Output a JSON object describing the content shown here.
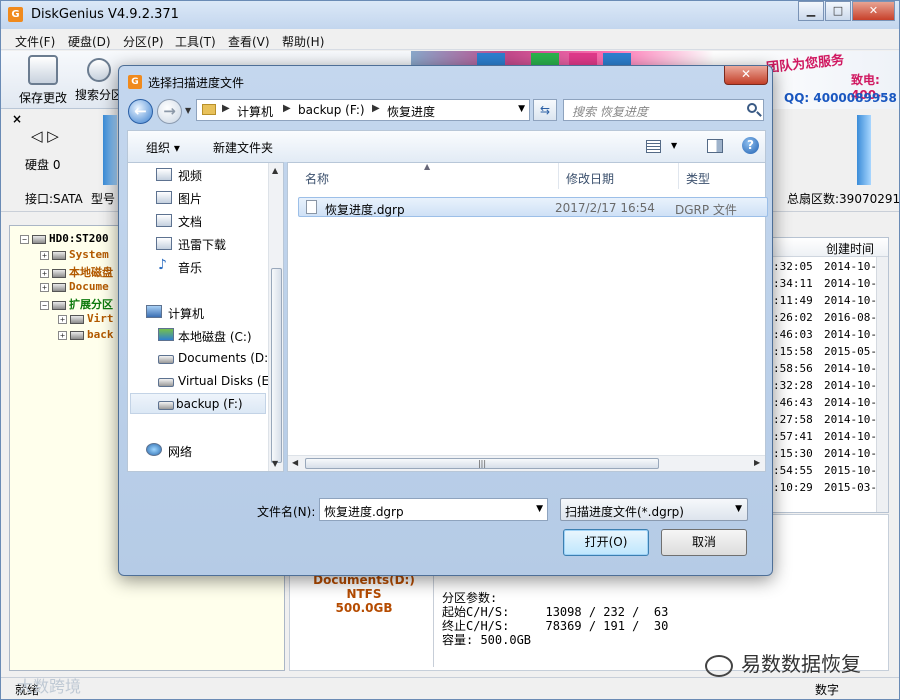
{
  "app": {
    "title": "DiskGenius V4.9.2.371",
    "logo": "G",
    "window_buttons": [
      "▁",
      "□",
      "✕"
    ]
  },
  "menu": [
    "文件(F)",
    "硬盘(D)",
    "分区(P)",
    "工具(T)",
    "查看(V)",
    "帮助(H)"
  ],
  "toolbar": {
    "save_label": "保存更改",
    "search_label": "搜索分区"
  },
  "banner": {
    "text1": "团队为您服务",
    "text2": "致电: 400-",
    "qq": "QQ: 4000089958"
  },
  "diskstrip": {
    "close": "×",
    "arrows": "◁ ▷",
    "disk_label": "硬盘 0",
    "interface": "接口:SATA",
    "model": "型号",
    "total_sectors": "总扇区数:39070291"
  },
  "tree": [
    {
      "label": "HD0:ST200",
      "indent": 0,
      "color": "#000000"
    },
    {
      "label": "System",
      "indent": 1,
      "color": "#b35a00"
    },
    {
      "label": "本地磁盘",
      "indent": 1,
      "color": "#b35a00"
    },
    {
      "label": "Docume",
      "indent": 1,
      "color": "#b35a00"
    },
    {
      "label": "扩展分区",
      "indent": 1,
      "color": "#0d7a0d"
    },
    {
      "label": "Virt",
      "indent": 2,
      "color": "#b35a00"
    },
    {
      "label": "back",
      "indent": 2,
      "color": "#b35a00"
    }
  ],
  "list": {
    "header": "创建时间",
    "rows": [
      {
        "time": ":32:05",
        "date": "2014-10-"
      },
      {
        "time": ":34:11",
        "date": "2014-10-"
      },
      {
        "time": ":11:49",
        "date": "2014-10-"
      },
      {
        "time": ":26:02",
        "date": "2016-08-"
      },
      {
        "time": ":46:03",
        "date": "2014-10-"
      },
      {
        "time": ":15:58",
        "date": "2015-05-"
      },
      {
        "time": ":58:56",
        "date": "2014-10-"
      },
      {
        "time": ":32:28",
        "date": "2014-10-"
      },
      {
        "time": ":46:43",
        "date": "2014-10-"
      },
      {
        "time": ":27:58",
        "date": "2014-10-"
      },
      {
        "time": ":57:41",
        "date": "2014-10-"
      },
      {
        "time": ":15:30",
        "date": "2014-10-"
      },
      {
        "time": ":54:55",
        "date": "2015-10-"
      },
      {
        "time": ":10:29",
        "date": "2015-03-"
      }
    ]
  },
  "partition": {
    "name": "Documents(D:)",
    "fs": "NTFS",
    "size": "500.0GB",
    "params_title": "分区参数:",
    "start": "起始C/H/S:     13098 / 232 /  63",
    "end": "终止C/H/S:     78369 / 191 /  30",
    "capacity": "容量: 500.0GB"
  },
  "status": {
    "left": "就绪",
    "right": "数字"
  },
  "watermarks": {
    "left": "大数跨境",
    "right": "易数数据恢复"
  },
  "dialog": {
    "title": "选择扫描进度文件",
    "logo": "G",
    "close": "✕",
    "breadcrumb": [
      "计算机",
      "backup (F:)",
      "恢复进度"
    ],
    "search_placeholder": "搜索 恢复进度",
    "organize": "组织 ▾",
    "new_folder": "新建文件夹",
    "help": "?",
    "nav": {
      "favorites": [
        "视频",
        "图片",
        "文档",
        "迅雷下载",
        "音乐"
      ],
      "computer": "计算机",
      "drives": [
        "本地磁盘 (C:)",
        "Documents (D:)",
        "Virtual Disks (E:",
        "backup (F:)"
      ],
      "network": "网络"
    },
    "columns": [
      "名称",
      "修改日期",
      "类型"
    ],
    "file": {
      "name": "恢复进度.dgrp",
      "date": "2017/2/17 16:54",
      "type": "DGRP 文件"
    },
    "filename_label": "文件名(N):",
    "filename_value": "恢复进度.dgrp",
    "filter": "扫描进度文件(*.dgrp)",
    "open_label": "打开(O)",
    "cancel_label": "取消"
  }
}
